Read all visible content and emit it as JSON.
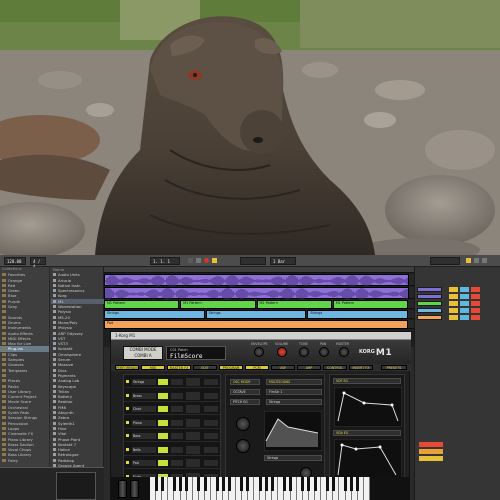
{
  "transport": {
    "tempo": "120.00",
    "signature": "4 / 4",
    "position": "1. 1. 1",
    "zoom": "1 Bar"
  },
  "browser": {
    "categories_header": "Collections",
    "categories": [
      {
        "label": "Favorites"
      },
      {
        "label": "Orange"
      },
      {
        "label": "Red"
      },
      {
        "label": "Green"
      },
      {
        "label": "Blue"
      },
      {
        "label": "Purple"
      },
      {
        "label": "Gray"
      },
      {
        "label": ""
      },
      {
        "label": "Sounds"
      },
      {
        "label": "Drums"
      },
      {
        "label": "Instruments"
      },
      {
        "label": "Audio Effects"
      },
      {
        "label": "MIDI Effects"
      },
      {
        "label": "Max for Live"
      },
      {
        "label": "Plug-ins",
        "selected": true
      },
      {
        "label": "Clips"
      },
      {
        "label": "Samples"
      },
      {
        "label": "Grooves"
      },
      {
        "label": "Templates"
      },
      {
        "label": ""
      },
      {
        "label": "Places"
      },
      {
        "label": "Packs"
      },
      {
        "label": "User Library"
      },
      {
        "label": "Current Project"
      },
      {
        "label": "Movie Score"
      },
      {
        "label": "Orchestral"
      },
      {
        "label": "Synth Pads"
      },
      {
        "label": "Session Strings"
      },
      {
        "label": "Percussion"
      },
      {
        "label": "Loops"
      },
      {
        "label": "Cinematic FX"
      },
      {
        "label": "Piano Library"
      },
      {
        "label": "Brass Section"
      },
      {
        "label": "Vocal Chops"
      },
      {
        "label": "Bass Library"
      },
      {
        "label": "Foley"
      }
    ],
    "files_header": "Name",
    "files": [
      {
        "label": "Audio Units"
      },
      {
        "label": "Arturia"
      },
      {
        "label": "Native Instr."
      },
      {
        "label": "Spectrasonics"
      },
      {
        "label": "Korg"
      },
      {
        "label": "M1",
        "selected": true
      },
      {
        "label": "Wavestation"
      },
      {
        "label": "Polysix"
      },
      {
        "label": "MS-20"
      },
      {
        "label": "Mono/Poly"
      },
      {
        "label": "iPolysix"
      },
      {
        "label": "ARP Odyssey"
      },
      {
        "label": "VST"
      },
      {
        "label": "VST3"
      },
      {
        "label": "Kontakt"
      },
      {
        "label": "Omnisphere"
      },
      {
        "label": "Serum"
      },
      {
        "label": "Massive"
      },
      {
        "label": "Diva"
      },
      {
        "label": "Pigments"
      },
      {
        "label": "Analog Lab"
      },
      {
        "label": "Keyscape"
      },
      {
        "label": "Trilian"
      },
      {
        "label": "Battery"
      },
      {
        "label": "Reaktor"
      },
      {
        "label": "FM8"
      },
      {
        "label": "Absynth"
      },
      {
        "label": "Zebra"
      },
      {
        "label": "Sylenth1"
      },
      {
        "label": "Hive"
      },
      {
        "label": "Vital"
      },
      {
        "label": "Phase Plant"
      },
      {
        "label": "Kontakt 7"
      },
      {
        "label": "Halion"
      },
      {
        "label": "Retrologue"
      },
      {
        "label": "Padshop"
      },
      {
        "label": "Groove Agent"
      }
    ]
  },
  "arrangement": {
    "tracks": [
      {
        "type": "audio",
        "color": "#8f70d8"
      },
      {
        "type": "audio",
        "color": "#8f70d8"
      },
      {
        "type": "midi",
        "color": "#62d64a",
        "clips": [
          "M1 Pattern",
          "M1 Pattern",
          "M1 Pattern",
          "M1 Pattern"
        ]
      },
      {
        "type": "midi",
        "color": "#6fb7e0",
        "clips": [
          "Strings",
          "Strings",
          "Strings"
        ]
      },
      {
        "type": "midi",
        "color": "#f2a25a",
        "clips": [
          "Pad"
        ]
      }
    ]
  },
  "plugin": {
    "window_title": "1-Korg M1",
    "mode_lines": [
      "COMBI MODE",
      "COMBI A"
    ],
    "patch_name": "C01 Patch",
    "patch_value": "FilmScore",
    "knobs": [
      "ENVELOPE",
      "VOLUME",
      "TONE",
      "PAN",
      "MASTER"
    ],
    "brand_prefix": "KORG",
    "brand": "M1",
    "tabs": [
      "PERFORMANCE",
      "MIX",
      "MASTER FX",
      "EDIT",
      "PROGRAM",
      "PCM",
      "VDF",
      "ARP",
      "CONTROL",
      "INSERT FX"
    ],
    "tab_right": "PRESETS",
    "timbres": [
      {
        "name": "Strings"
      },
      {
        "name": "Brass"
      },
      {
        "name": "Choir"
      },
      {
        "name": "Piano"
      },
      {
        "name": "Bass"
      },
      {
        "name": "Bells"
      },
      {
        "name": "Pad"
      },
      {
        "name": "Flute"
      }
    ],
    "center": {
      "osc_mode": "OSC MODE",
      "multisound": "MULTISOUND",
      "octave": "OCTAVE",
      "pitch_eg": "PITCH EG",
      "select_label": "FlmStr 1",
      "select_label_2": "Strings",
      "wave": "Strings"
    },
    "right": {
      "header": "VDF EG",
      "header_2": "VDA EG"
    },
    "bottom": {
      "field_1": "Ensemble Hall",
      "field_2": "Medium",
      "label": "MASTER"
    }
  },
  "mixer": {
    "slot_colors": [
      "#7d6fd2",
      "#7d6fd2",
      "#5fd64a",
      "#6fb7e0",
      "#f2a25a"
    ],
    "button_colors": [
      "#e8c038",
      "#5fb8e0",
      "#e64a36"
    ]
  }
}
